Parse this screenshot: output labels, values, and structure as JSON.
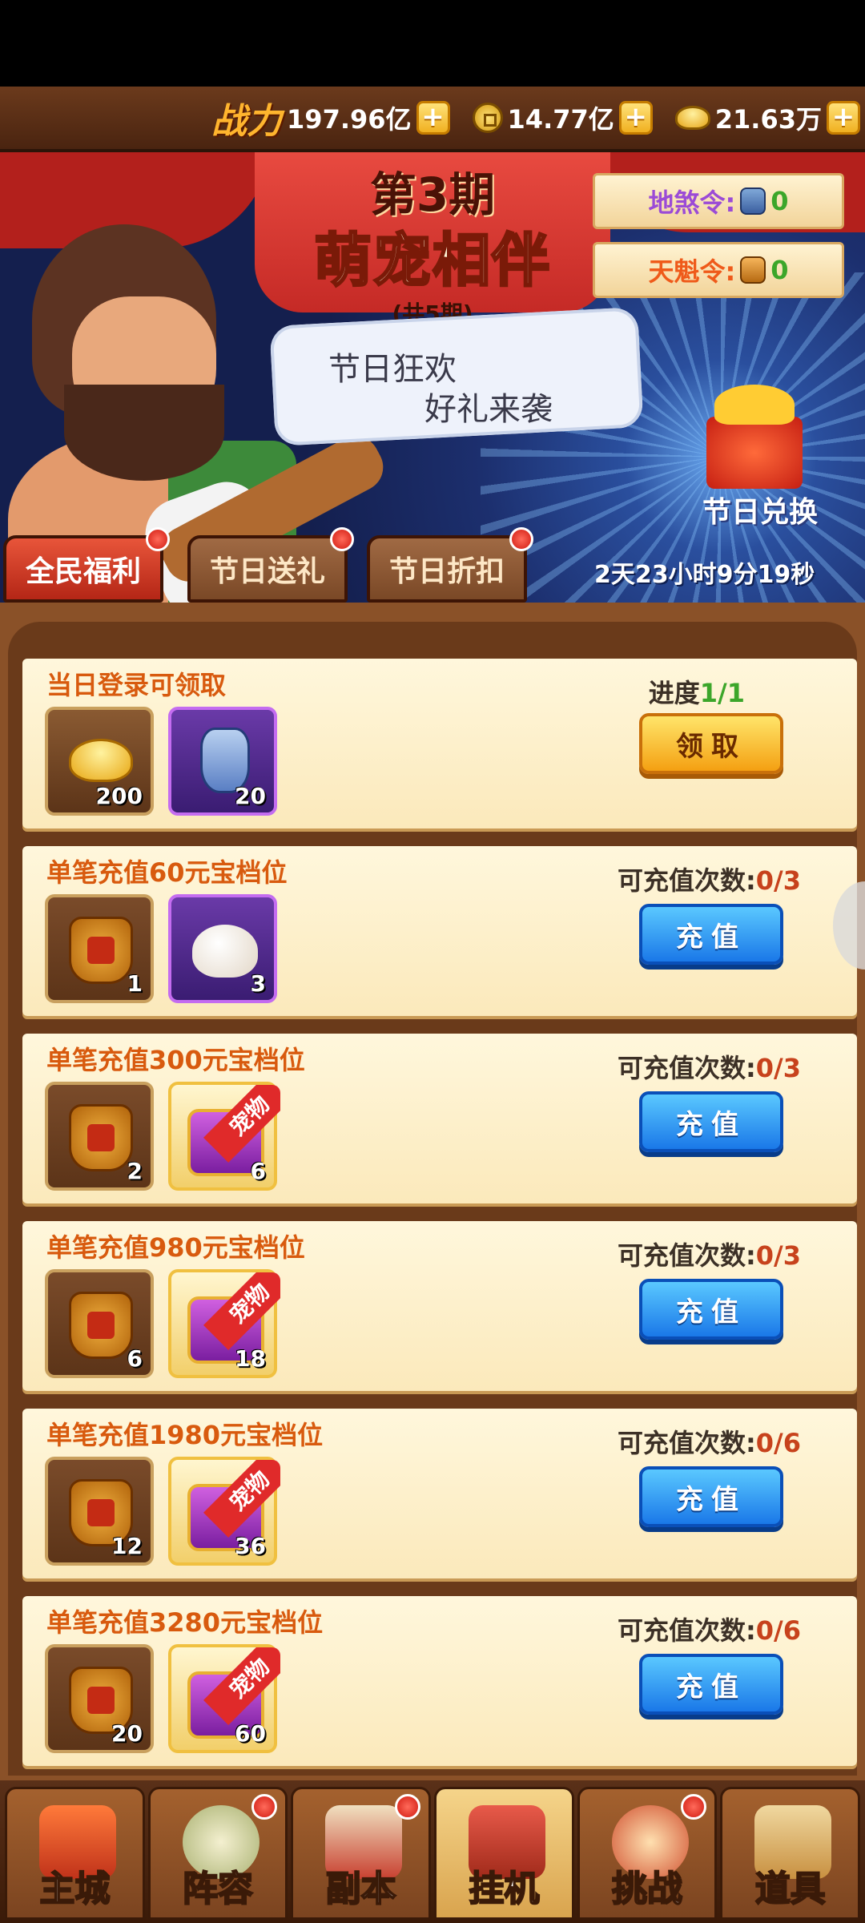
{
  "top_bar": {
    "power_label": "战力",
    "power_value": "197.96亿",
    "coin_value": "14.77亿",
    "gold_value": "21.63万",
    "plus": "+"
  },
  "banner": {
    "period": "第3期",
    "title": "萌宠相伴",
    "period_count": "(共5期)",
    "speech_line1": "节日狂欢",
    "speech_line2": "好礼来袭",
    "tokens": {
      "earth_label": "地煞令:",
      "earth_count": "0",
      "heaven_label": "天魁令:",
      "heaven_count": "0"
    },
    "exchange_label": "节日兑换",
    "countdown": "2天23小时9分19秒",
    "tabs": [
      "全民福利",
      "节日送礼",
      "节日折扣"
    ]
  },
  "rewards": [
    {
      "title": "当日登录可领取",
      "progress_label": "进度",
      "progress_value": "1/1",
      "button": "领取",
      "items": [
        {
          "icon": "gold-ingot-icon",
          "count": "200"
        },
        {
          "icon": "blue-bag-icon",
          "count": "20"
        }
      ]
    },
    {
      "title": "单笔充值60元宝档位",
      "progress_label": "可充值次数:",
      "progress_value": "0/3",
      "button": "充值",
      "items": [
        {
          "icon": "kui-token-icon",
          "count": "1"
        },
        {
          "icon": "steamed-bun-icon",
          "count": "3"
        }
      ]
    },
    {
      "title": "单笔充值300元宝档位",
      "progress_label": "可充值次数:",
      "progress_value": "0/3",
      "button": "充值",
      "items": [
        {
          "icon": "kui-token-icon",
          "count": "2"
        },
        {
          "icon": "pet-chest-icon",
          "count": "6",
          "ribbon": "宠物"
        }
      ]
    },
    {
      "title": "单笔充值980元宝档位",
      "progress_label": "可充值次数:",
      "progress_value": "0/3",
      "button": "充值",
      "items": [
        {
          "icon": "kui-token-icon",
          "count": "6"
        },
        {
          "icon": "pet-chest-icon",
          "count": "18",
          "ribbon": "宠物"
        }
      ]
    },
    {
      "title": "单笔充值1980元宝档位",
      "progress_label": "可充值次数:",
      "progress_value": "0/6",
      "button": "充值",
      "items": [
        {
          "icon": "kui-token-icon",
          "count": "12"
        },
        {
          "icon": "pet-chest-icon",
          "count": "36",
          "ribbon": "宠物"
        }
      ]
    },
    {
      "title": "单笔充值3280元宝档位",
      "progress_label": "可充值次数:",
      "progress_value": "0/6",
      "button": "充值",
      "items": [
        {
          "icon": "kui-token-icon",
          "count": "20"
        },
        {
          "icon": "pet-chest-icon",
          "count": "60",
          "ribbon": "宠物"
        }
      ]
    }
  ],
  "bottom_nav": [
    "主城",
    "阵容",
    "副本",
    "挂机",
    "挑战",
    "道具"
  ]
}
